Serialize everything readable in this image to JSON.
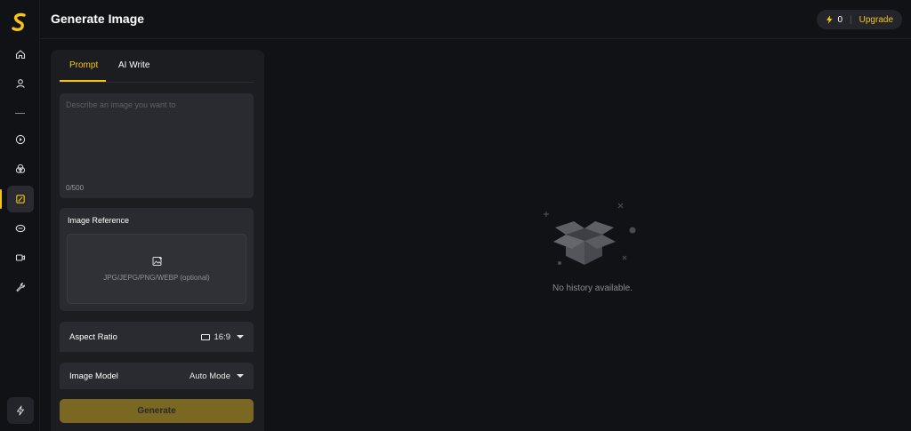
{
  "app": {
    "title": "Generate Image"
  },
  "header": {
    "credits": "0",
    "upgrade_label": "Upgrade"
  },
  "sidebar": {
    "items": [
      {
        "icon": "home-icon"
      },
      {
        "icon": "user-icon"
      },
      {
        "icon": "play-icon"
      },
      {
        "icon": "circles-icon"
      },
      {
        "icon": "image-edit-icon",
        "active": true
      },
      {
        "icon": "mask-icon"
      },
      {
        "icon": "video-icon"
      },
      {
        "icon": "wrench-icon"
      }
    ],
    "bottom_icon": "flash-icon"
  },
  "tabs": [
    {
      "label": "Prompt",
      "active": true
    },
    {
      "label": "AI Write",
      "active": false
    }
  ],
  "prompt": {
    "placeholder": "Describe an image you want to",
    "value": "",
    "char_count": "0/500"
  },
  "image_reference": {
    "label": "Image Reference",
    "hint": "JPG/JEPG/PNG/WEBP (optional)"
  },
  "aspect_ratio": {
    "label": "Aspect Ratio",
    "value": "16:9"
  },
  "image_model": {
    "label": "Image Model",
    "value": "Auto Mode"
  },
  "generate_label": "Generate",
  "history": {
    "empty_text": "No history available."
  },
  "colors": {
    "accent": "#f5c518",
    "background": "#111216",
    "panel": "#1c1d21"
  }
}
